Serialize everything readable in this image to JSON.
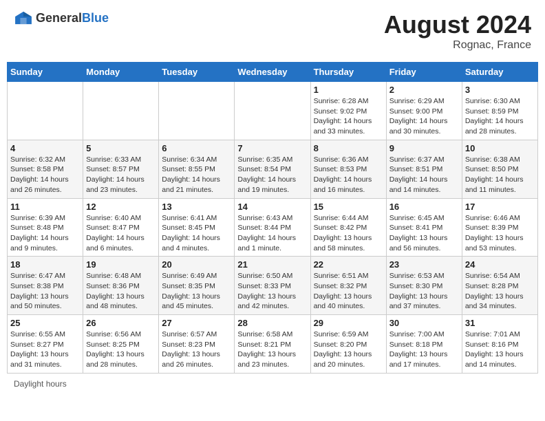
{
  "header": {
    "logo_general": "General",
    "logo_blue": "Blue",
    "month_year": "August 2024",
    "location": "Rognac, France"
  },
  "footer": {
    "daylight_label": "Daylight hours"
  },
  "calendar": {
    "days_of_week": [
      "Sunday",
      "Monday",
      "Tuesday",
      "Wednesday",
      "Thursday",
      "Friday",
      "Saturday"
    ],
    "weeks": [
      [
        {
          "day": "",
          "info": ""
        },
        {
          "day": "",
          "info": ""
        },
        {
          "day": "",
          "info": ""
        },
        {
          "day": "",
          "info": ""
        },
        {
          "day": "1",
          "info": "Sunrise: 6:28 AM\nSunset: 9:02 PM\nDaylight: 14 hours\nand 33 minutes."
        },
        {
          "day": "2",
          "info": "Sunrise: 6:29 AM\nSunset: 9:00 PM\nDaylight: 14 hours\nand 30 minutes."
        },
        {
          "day": "3",
          "info": "Sunrise: 6:30 AM\nSunset: 8:59 PM\nDaylight: 14 hours\nand 28 minutes."
        }
      ],
      [
        {
          "day": "4",
          "info": "Sunrise: 6:32 AM\nSunset: 8:58 PM\nDaylight: 14 hours\nand 26 minutes."
        },
        {
          "day": "5",
          "info": "Sunrise: 6:33 AM\nSunset: 8:57 PM\nDaylight: 14 hours\nand 23 minutes."
        },
        {
          "day": "6",
          "info": "Sunrise: 6:34 AM\nSunset: 8:55 PM\nDaylight: 14 hours\nand 21 minutes."
        },
        {
          "day": "7",
          "info": "Sunrise: 6:35 AM\nSunset: 8:54 PM\nDaylight: 14 hours\nand 19 minutes."
        },
        {
          "day": "8",
          "info": "Sunrise: 6:36 AM\nSunset: 8:53 PM\nDaylight: 14 hours\nand 16 minutes."
        },
        {
          "day": "9",
          "info": "Sunrise: 6:37 AM\nSunset: 8:51 PM\nDaylight: 14 hours\nand 14 minutes."
        },
        {
          "day": "10",
          "info": "Sunrise: 6:38 AM\nSunset: 8:50 PM\nDaylight: 14 hours\nand 11 minutes."
        }
      ],
      [
        {
          "day": "11",
          "info": "Sunrise: 6:39 AM\nSunset: 8:48 PM\nDaylight: 14 hours\nand 9 minutes."
        },
        {
          "day": "12",
          "info": "Sunrise: 6:40 AM\nSunset: 8:47 PM\nDaylight: 14 hours\nand 6 minutes."
        },
        {
          "day": "13",
          "info": "Sunrise: 6:41 AM\nSunset: 8:45 PM\nDaylight: 14 hours\nand 4 minutes."
        },
        {
          "day": "14",
          "info": "Sunrise: 6:43 AM\nSunset: 8:44 PM\nDaylight: 14 hours\nand 1 minute."
        },
        {
          "day": "15",
          "info": "Sunrise: 6:44 AM\nSunset: 8:42 PM\nDaylight: 13 hours\nand 58 minutes."
        },
        {
          "day": "16",
          "info": "Sunrise: 6:45 AM\nSunset: 8:41 PM\nDaylight: 13 hours\nand 56 minutes."
        },
        {
          "day": "17",
          "info": "Sunrise: 6:46 AM\nSunset: 8:39 PM\nDaylight: 13 hours\nand 53 minutes."
        }
      ],
      [
        {
          "day": "18",
          "info": "Sunrise: 6:47 AM\nSunset: 8:38 PM\nDaylight: 13 hours\nand 50 minutes."
        },
        {
          "day": "19",
          "info": "Sunrise: 6:48 AM\nSunset: 8:36 PM\nDaylight: 13 hours\nand 48 minutes."
        },
        {
          "day": "20",
          "info": "Sunrise: 6:49 AM\nSunset: 8:35 PM\nDaylight: 13 hours\nand 45 minutes."
        },
        {
          "day": "21",
          "info": "Sunrise: 6:50 AM\nSunset: 8:33 PM\nDaylight: 13 hours\nand 42 minutes."
        },
        {
          "day": "22",
          "info": "Sunrise: 6:51 AM\nSunset: 8:32 PM\nDaylight: 13 hours\nand 40 minutes."
        },
        {
          "day": "23",
          "info": "Sunrise: 6:53 AM\nSunset: 8:30 PM\nDaylight: 13 hours\nand 37 minutes."
        },
        {
          "day": "24",
          "info": "Sunrise: 6:54 AM\nSunset: 8:28 PM\nDaylight: 13 hours\nand 34 minutes."
        }
      ],
      [
        {
          "day": "25",
          "info": "Sunrise: 6:55 AM\nSunset: 8:27 PM\nDaylight: 13 hours\nand 31 minutes."
        },
        {
          "day": "26",
          "info": "Sunrise: 6:56 AM\nSunset: 8:25 PM\nDaylight: 13 hours\nand 28 minutes."
        },
        {
          "day": "27",
          "info": "Sunrise: 6:57 AM\nSunset: 8:23 PM\nDaylight: 13 hours\nand 26 minutes."
        },
        {
          "day": "28",
          "info": "Sunrise: 6:58 AM\nSunset: 8:21 PM\nDaylight: 13 hours\nand 23 minutes."
        },
        {
          "day": "29",
          "info": "Sunrise: 6:59 AM\nSunset: 8:20 PM\nDaylight: 13 hours\nand 20 minutes."
        },
        {
          "day": "30",
          "info": "Sunrise: 7:00 AM\nSunset: 8:18 PM\nDaylight: 13 hours\nand 17 minutes."
        },
        {
          "day": "31",
          "info": "Sunrise: 7:01 AM\nSunset: 8:16 PM\nDaylight: 13 hours\nand 14 minutes."
        }
      ]
    ]
  }
}
